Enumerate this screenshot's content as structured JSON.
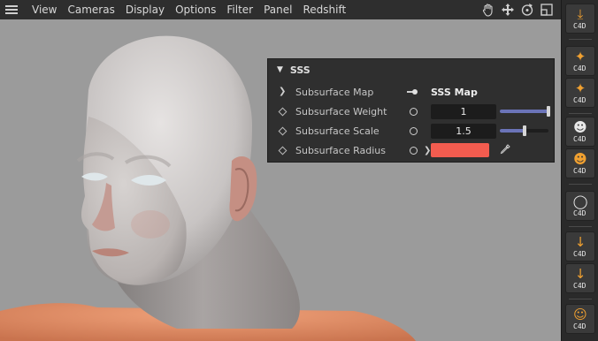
{
  "menu": {
    "items": [
      "View",
      "Cameras",
      "Display",
      "Options",
      "Filter",
      "Panel",
      "Redshift"
    ],
    "tool_icons": [
      "hand-icon",
      "move-icon",
      "rotate-icon",
      "layout-icon"
    ]
  },
  "sss_panel": {
    "title": "SSS",
    "rows": [
      {
        "label": "Subsurface Map",
        "value": "SSS Map"
      },
      {
        "label": "Subsurface Weight",
        "value": "1",
        "slider_fraction": 1.0
      },
      {
        "label": "Subsurface Scale",
        "value": "1.5",
        "slider_fraction": 0.5
      },
      {
        "label": "Subsurface Radius",
        "color": "#f25c4f"
      }
    ]
  },
  "colors": {
    "slider_fill": "#6b74b8",
    "accent_orange": "#f0a030",
    "viewport_bg": "#9b9b9b"
  },
  "right_toolbar": {
    "buttons": [
      {
        "icon": "download-icon",
        "caption": "C4D"
      },
      {
        "icon": "figure-icon",
        "caption": "C4D"
      },
      {
        "icon": "figure-pose-icon",
        "caption": "C4D"
      },
      {
        "icon": "face-texture-icon",
        "caption": "C4D"
      },
      {
        "icon": "face-skin-icon",
        "caption": "C4D"
      },
      {
        "icon": "sphere-icon",
        "caption": "C4D"
      },
      {
        "icon": "run-figure-icon",
        "caption": "C4D"
      },
      {
        "icon": "pose-brush-icon",
        "caption": "C4D"
      },
      {
        "icon": "expression-icon",
        "caption": "C4D"
      }
    ]
  }
}
